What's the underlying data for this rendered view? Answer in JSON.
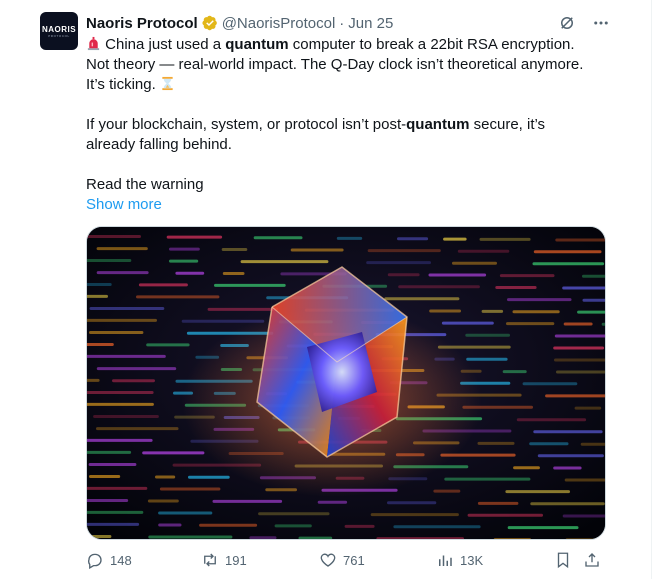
{
  "tweet": {
    "author_name": "Naoris Protocol",
    "handle": "@NaorisProtocol",
    "separator": "·",
    "date": "Jun 25",
    "avatar_text": "NAORIS",
    "avatar_subtext": "PROTOCOL",
    "line1_pre": "China just used a ",
    "line1_bold": "quantum",
    "line1_post": " computer to break a 22bit RSA encryption.",
    "line2": "Not theory — real-world impact. The Q-Day clock isn’t theoretical anymore.",
    "line3": "It’s ticking.",
    "para2_pre": "If your blockchain, system, or protocol isn’t post-",
    "para2_bold": "quantum",
    "para2_post": " secure, it’s",
    "para2_line2": "already falling behind.",
    "para3": "Read the warning",
    "show_more": "Show more"
  },
  "actions": {
    "replies": "148",
    "reposts": "191",
    "likes": "761",
    "views": "13K"
  },
  "colors": {
    "accent": "#1d9bf0",
    "secondary_text": "#536471",
    "verified_gold": "#e2b719"
  }
}
